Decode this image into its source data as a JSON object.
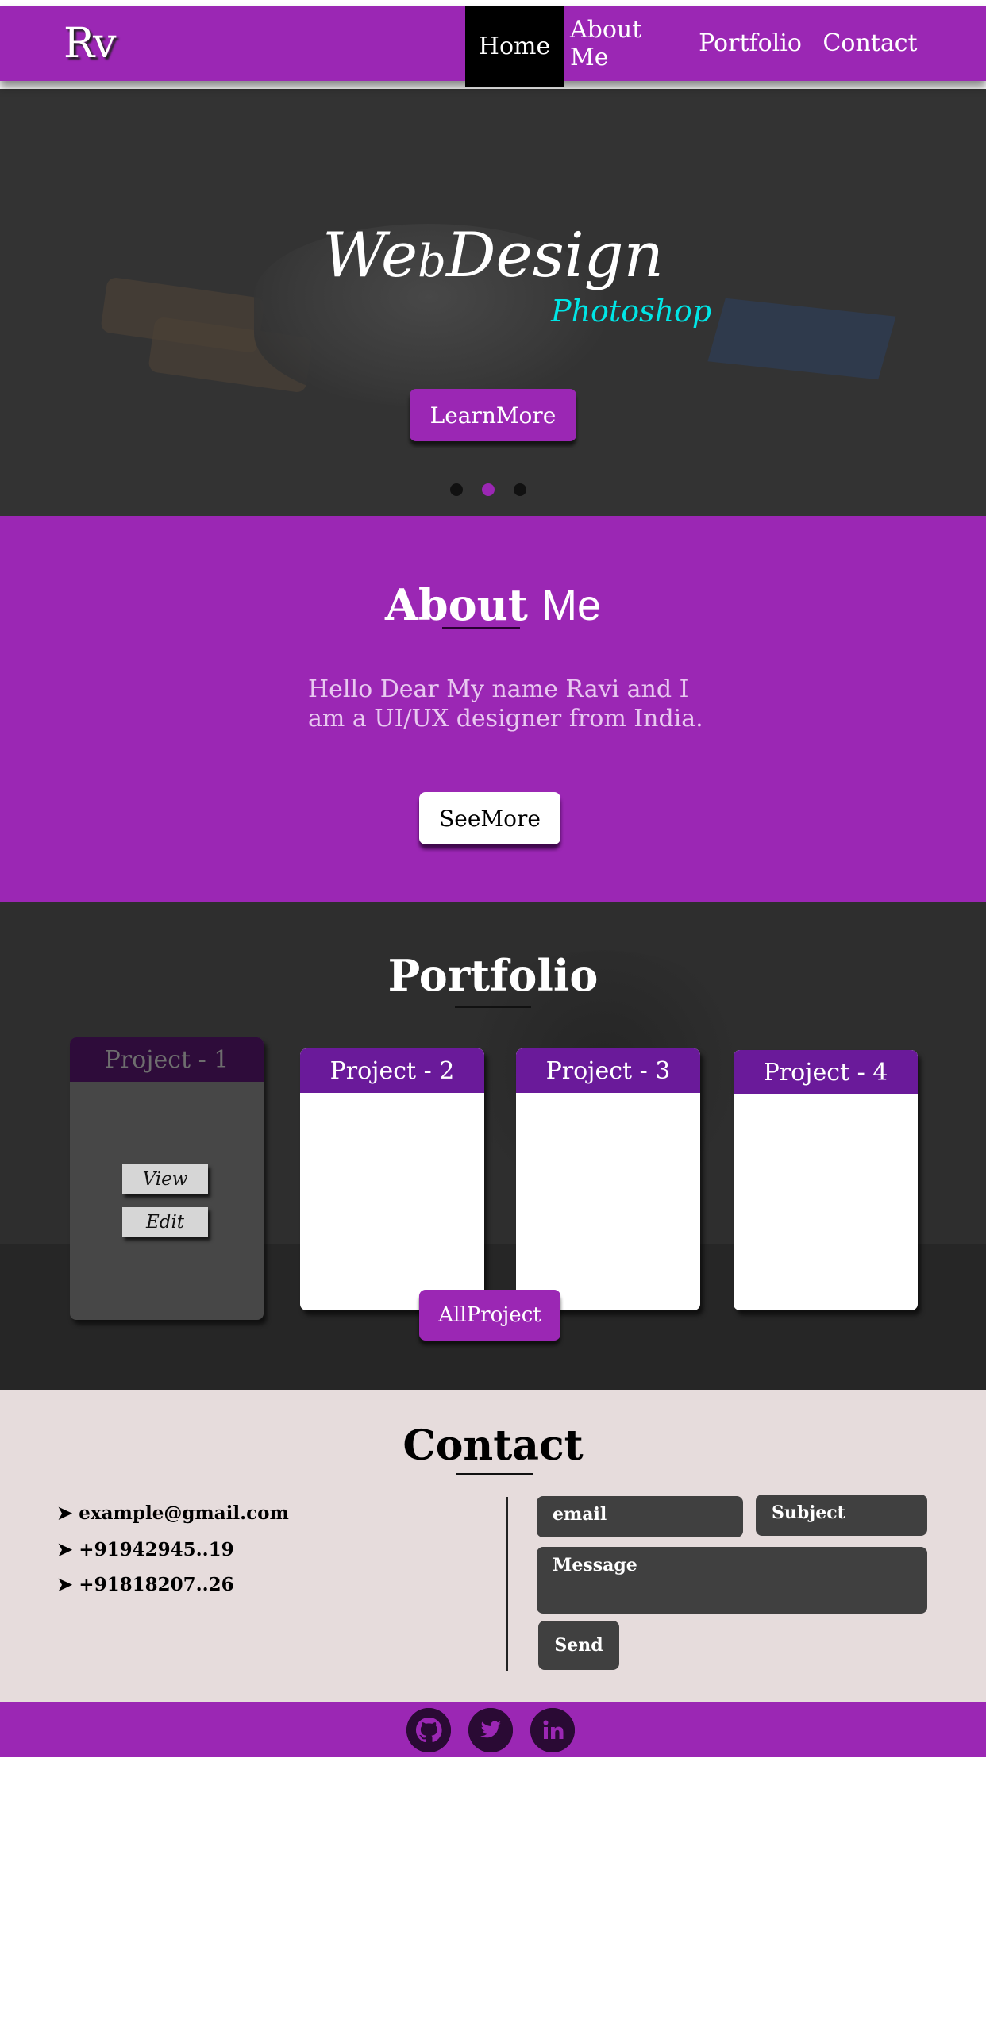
{
  "nav": {
    "logo": "Rv",
    "items": [
      "Home",
      "About Me",
      "Portfolio",
      "Contact"
    ],
    "active": "Home"
  },
  "hero": {
    "title_we": "We",
    "title_b": "b",
    "title_design": "Design",
    "subtitle": "Photoshop",
    "button": "LearnMore",
    "slides": 3,
    "active_slide": 2
  },
  "about": {
    "heading_bold": "About",
    "heading_light": "Me",
    "text": "Hello Dear My name Ravi and  I am a UI/UX  designer from India.",
    "button": "SeeMore"
  },
  "portfolio": {
    "heading": "Portfolio",
    "projects": [
      {
        "label": "Project - 1",
        "actions": [
          "View",
          "Edit"
        ]
      },
      {
        "label": "Project - 2"
      },
      {
        "label": "Project - 3"
      },
      {
        "label": "Project - 4"
      }
    ],
    "button": "AllProject"
  },
  "contact": {
    "heading": "Contact",
    "info": [
      "example@gmail.com",
      "+91942945..19",
      "+91818207..26"
    ],
    "arrow": "➤",
    "form": {
      "email_placeholder": "email",
      "subject_placeholder": "Subject",
      "message_placeholder": "Message",
      "send": "Send"
    }
  },
  "footer": {
    "icons": [
      "github-icon",
      "twitter-icon",
      "linkedin-icon"
    ]
  },
  "colors": {
    "brand": "#9b27b4",
    "accent_cyan": "#00e6e6",
    "dark": "#333333",
    "contact_bg": "#e6dcdc"
  }
}
